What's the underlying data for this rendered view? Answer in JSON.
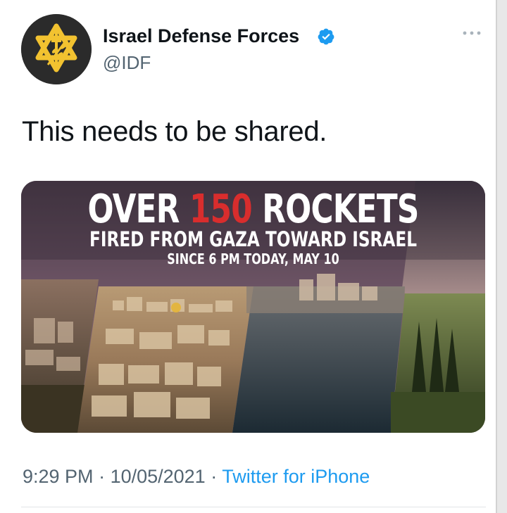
{
  "author": {
    "name": "Israel Defense Forces",
    "handle": "@IDF",
    "verified": true
  },
  "tweet": {
    "text": "This needs to be shared."
  },
  "media": {
    "headline_prefix": "OVER ",
    "headline_number": "150",
    "headline_suffix": " ROCKETS",
    "subheadline": "FIRED FROM GAZA TOWARD ISRAEL",
    "dateline": "SINCE 6 PM TODAY, MAY 10"
  },
  "meta": {
    "time": "9:29 PM",
    "separator": " · ",
    "date": "10/05/2021",
    "source": "Twitter for iPhone"
  },
  "colors": {
    "text_primary": "#0f1419",
    "text_secondary": "#536471",
    "link": "#1d9bf0",
    "verified_badge": "#1d9bf0",
    "headline_accent": "#d92d2d",
    "avatar_bg": "#2b2b2b",
    "emblem": "#f2c230"
  },
  "icons": {
    "avatar": "idf-emblem-icon",
    "verified": "verified-badge-icon",
    "more": "more-options-icon"
  }
}
